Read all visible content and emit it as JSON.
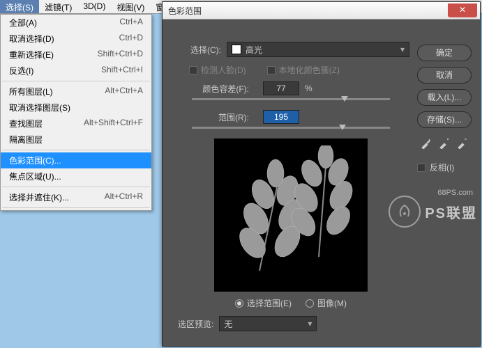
{
  "menubar": {
    "items": [
      "选择(S)",
      "滤镜(T)",
      "3D(D)",
      "视图(V)"
    ],
    "extra": "窗"
  },
  "dropdown": {
    "groups": [
      [
        {
          "label": "全部(A)",
          "shortcut": "Ctrl+A"
        },
        {
          "label": "取消选择(D)",
          "shortcut": "Ctrl+D"
        },
        {
          "label": "重新选择(E)",
          "shortcut": "Shift+Ctrl+D"
        },
        {
          "label": "反选(I)",
          "shortcut": "Shift+Ctrl+I"
        }
      ],
      [
        {
          "label": "所有图层(L)",
          "shortcut": "Alt+Ctrl+A"
        },
        {
          "label": "取消选择图层(S)",
          "shortcut": ""
        },
        {
          "label": "查找图层",
          "shortcut": "Alt+Shift+Ctrl+F"
        },
        {
          "label": "隔离图层",
          "shortcut": ""
        }
      ],
      [
        {
          "label": "色彩范围(C)...",
          "shortcut": "",
          "hl": true
        },
        {
          "label": "焦点区域(U)...",
          "shortcut": ""
        }
      ],
      [
        {
          "label": "选择并遮住(K)...",
          "shortcut": "Alt+Ctrl+R"
        }
      ]
    ]
  },
  "dialog": {
    "title": "色彩范围",
    "select_label": "选择(C):",
    "select_value": "高光",
    "chk_face": "检测人脸(D)",
    "chk_local": "本地化颜色簇(Z)",
    "fuzz_label": "颜色容差(F):",
    "fuzz_value": "77",
    "pct": "%",
    "range_label": "范围(R):",
    "range_value": "195",
    "radio_sel": "选择范围(E)",
    "radio_img": "图像(M)",
    "preview_label": "选区预览:",
    "preview_value": "无"
  },
  "buttons": {
    "ok": "确定",
    "cancel": "取消",
    "load": "载入(L)...",
    "save": "存储(S)...",
    "invert": "反相(I)"
  },
  "watermark": {
    "sub": "68PS.com",
    "text": "PS联盟"
  }
}
